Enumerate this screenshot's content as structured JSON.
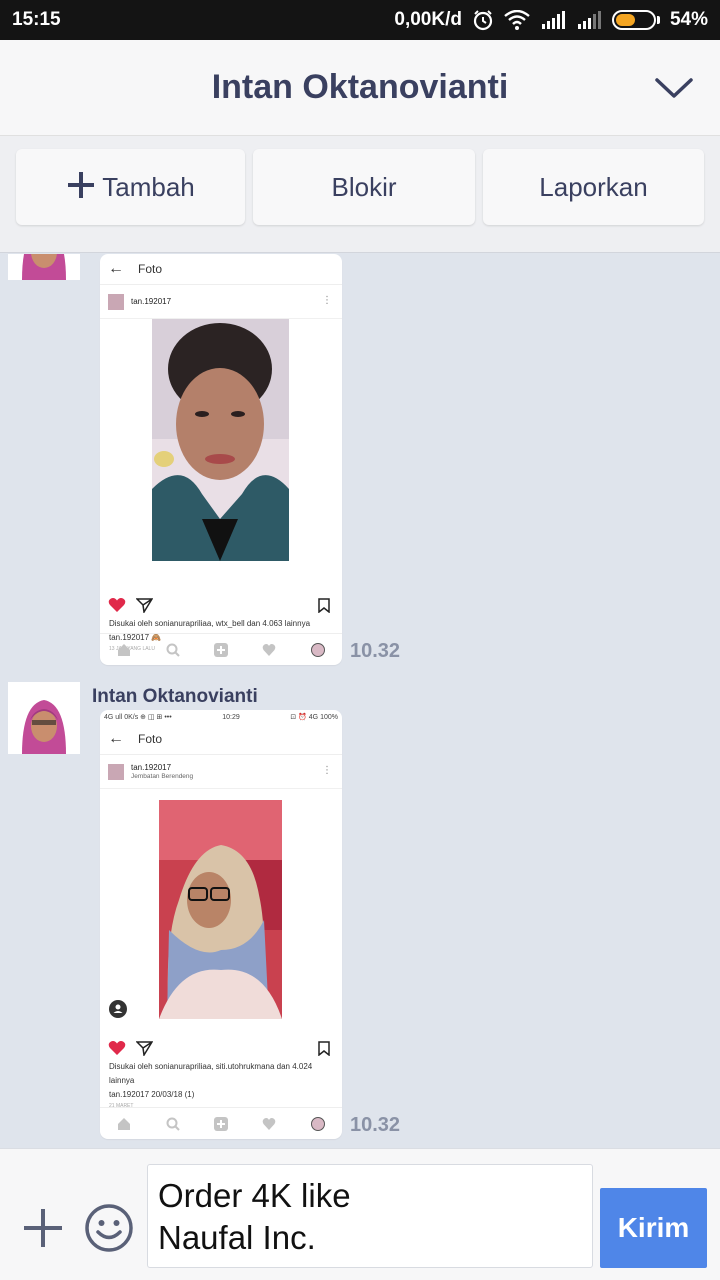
{
  "status": {
    "time": "15:15",
    "speed": "0,00K/d",
    "battery": "54%",
    "battery_level": 0.54
  },
  "header": {
    "title": "Intan Oktanovianti"
  },
  "actions": {
    "add": "Tambah",
    "block": "Blokir",
    "report": "Laporkan"
  },
  "messages": [
    {
      "time": "10.32",
      "shot": {
        "top_label": "Foto",
        "username": "tan.192017",
        "caption": "Disukai oleh sonianurapriliaa, wtx_bell dan 4.063 lainnya",
        "caption2": "tan.192017 🙈",
        "small": "13 JAM YANG LALU"
      }
    },
    {
      "sender": "Intan Oktanovianti",
      "time": "10.32",
      "shot": {
        "status_left": "4G ull 0K/s ⊕ ◫ ⊞ •••",
        "status_time": "10:29",
        "status_right": "⊡ ⏰ 4G 100%",
        "top_label": "Foto",
        "username": "tan.192017",
        "location": "Jembatan Berendeng",
        "caption": "Disukai oleh sonianurapriliaa, siti.utohrukmana dan 4.024 lainnya",
        "caption2": "tan.192017 20/03/18 (1)",
        "small": "21 MARET"
      }
    }
  ],
  "composer": {
    "text_line1": "Order 4K like",
    "text_line2": "Naufal Inc.",
    "send": "Kirim"
  },
  "colors": {
    "accent": "#4f86e8",
    "title": "#3a4060",
    "background": "#dfe4ec"
  }
}
